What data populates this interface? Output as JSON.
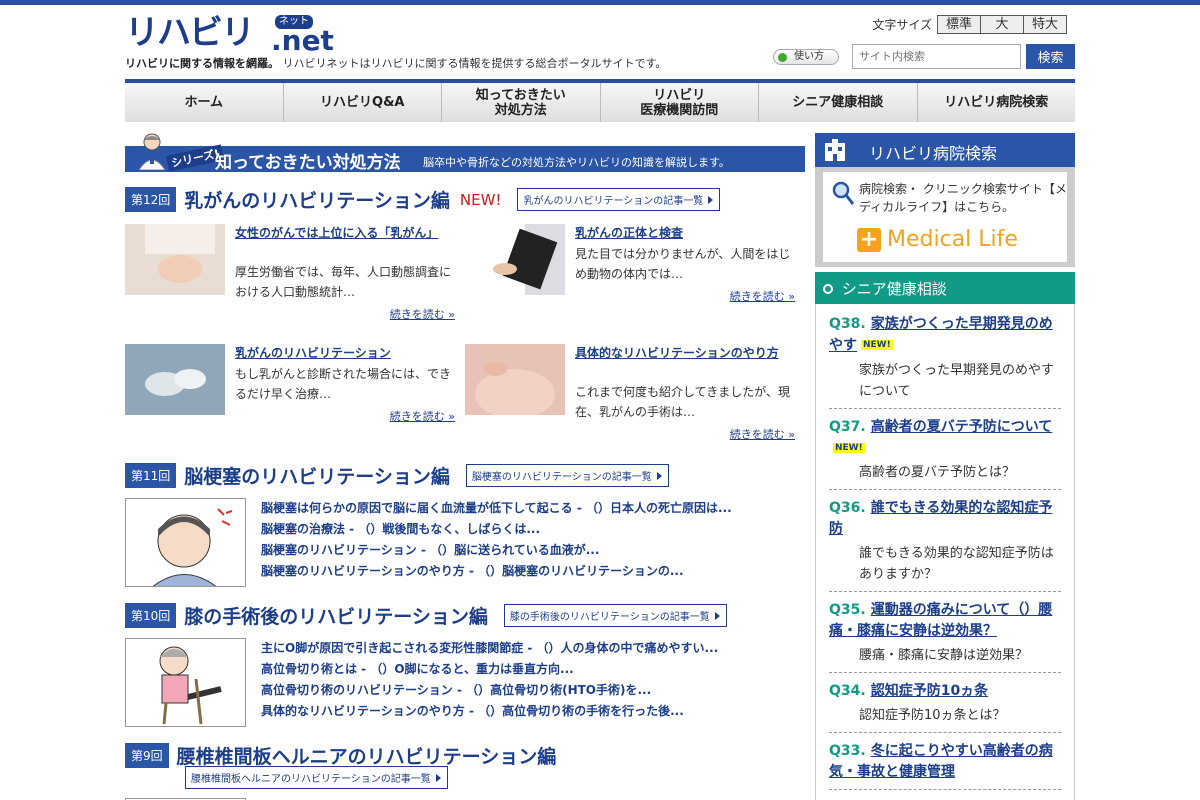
{
  "header": {
    "logo_main": "リハビリ",
    "logo_net": ".net",
    "logo_ruby": "ネット",
    "tagline_bold": "リハビリに関する情報を網羅。",
    "tagline_text": "リハビリネットはリハビリに関する情報を提供する総合ポータルサイトです。",
    "font_size_label": "文字サイズ",
    "font_sizes": [
      "標準",
      "大",
      "特大"
    ],
    "howto_label": "使い方",
    "search_placeholder": "サイト内検索",
    "search_button": "検索"
  },
  "nav": [
    {
      "label": "ホーム"
    },
    {
      "label": "リハビリQ&A"
    },
    {
      "label": "知っておきたい\n対処方法"
    },
    {
      "label": "リハビリ\n医療機関訪問"
    },
    {
      "label": "シニア健康相談"
    },
    {
      "label": "リハビリ病院検索"
    }
  ],
  "series": {
    "tag": "シリーズ!",
    "title": "知っておきたい対処方法",
    "subtitle": "脳卒中や骨折などの対処方法やリハビリの知識を解説します。"
  },
  "episodes": [
    {
      "no": "第12回",
      "title": "乳がんのリハビリテーション編",
      "new": "NEW!",
      "list_btn": "乳がんのリハビリテーションの記事一覧",
      "articles": [
        {
          "title": "女性のがんでは上位に入る「乳がん」",
          "desc": "厚生労働省では、毎年、人口動態調査における人口動態統計…",
          "more": "続きを読む »",
          "thumb_color": "#e9dcd2"
        },
        {
          "title": "乳がんの正体と検査",
          "desc": "見た目では分かりませんが、人間をはじめ動物の体内では…",
          "more": "続きを読む »",
          "thumb_color": "#dcdde3"
        },
        {
          "title": "乳がんのリハビリテーション",
          "desc": "もし乳がんと診断された場合には、できるだけ早く治療…",
          "more": "続きを読む »",
          "thumb_color": "#8fa7b8"
        },
        {
          "title": "具体的なリハビリテーションのやり方",
          "desc": "これまで何度も紹介してきましたが、現在、乳がんの手術は…",
          "more": "続きを読む »",
          "thumb_color": "#e6c3b6"
        }
      ]
    },
    {
      "no": "第11回",
      "title": "脳梗塞のリハビリテーション編",
      "list_btn": "脳梗塞のリハビリテーションの記事一覧",
      "links": [
        "脳梗塞は何らかの原因で脳に届く血流量が低下して起こる - （）日本人の死亡原因は...",
        "脳梗塞の治療法 - （）戦後間もなく、しばらくは...",
        "脳梗塞のリハビリテーション - （）脳に送られている血液が...",
        "脳梗塞のリハビリテーションのやり方 - （）脳梗塞のリハビリテーションの..."
      ]
    },
    {
      "no": "第10回",
      "title": "膝の手術後のリハビリテーション編",
      "list_btn": "膝の手術後のリハビリテーションの記事一覧",
      "links": [
        "主にO脚が原因で引き起こされる変形性膝関節症 - （）人の身体の中で痛めやすい...",
        "高位骨切り術とは - （）O脚になると、重力は垂直方向...",
        "高位骨切り術のリハビリテーション - （）高位骨切り術(HTO手術)を...",
        "具体的なリハビリテーションのやり方 - （）高位骨切り術の手術を行った後..."
      ]
    },
    {
      "no": "第9回",
      "title": "腰椎椎間板ヘルニアのリハビリテーション編",
      "list_btn": "腰椎椎間板ヘルニアのリハビリテーションの記事一覧"
    }
  ],
  "sidebar": {
    "hospital_search_title": "リハビリ病院検索",
    "hospital_search_text": "病院検索・ クリニック検索サイト【メディカルライフ】はこちら。",
    "medical_life": "Medical Life",
    "senior_title": "シニア健康相談",
    "qa": [
      {
        "num": "Q38.",
        "title": "家族がつくった早期発見のめやす",
        "new": "NEW!",
        "answer": "家族がつくった早期発見のめやすについて"
      },
      {
        "num": "Q37.",
        "title": "高齢者の夏バテ予防について",
        "new": "NEW!",
        "answer": "高齢者の夏バテ予防とは？"
      },
      {
        "num": "Q36.",
        "title": "誰でもきる効果的な認知症予防",
        "answer": "誰でもきる効果的な認知症予防はありますか？"
      },
      {
        "num": "Q35.",
        "title": "運動器の痛みについて（）腰痛・膝痛に安静は逆効果？",
        "answer": "腰痛・膝痛に安静は逆効果？"
      },
      {
        "num": "Q34.",
        "title": "認知症予防10ヵ条",
        "answer": "認知症予防10ヵ条とは？"
      },
      {
        "num": "Q33.",
        "title": "冬に起こりやすい高齢者の病気・事故と健康管理",
        "answer": ""
      }
    ]
  },
  "colors": {
    "primary": "#2b55a6",
    "navy": "#1d3e8a",
    "teal": "#119a85",
    "new_red": "#d4161b",
    "medical_orange": "#f5a21c"
  }
}
